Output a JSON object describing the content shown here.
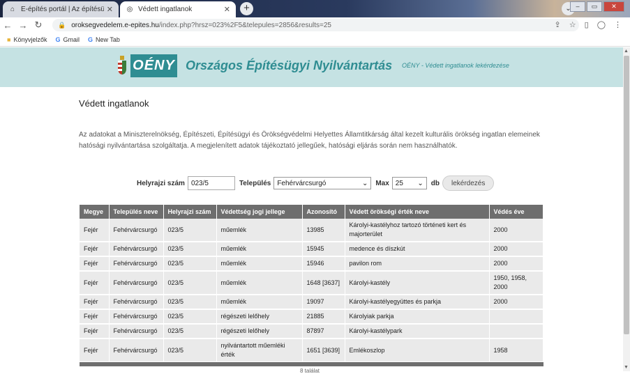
{
  "browser": {
    "tabs": [
      {
        "title": "E-építés portál | Az építésügy po",
        "icon": "home-icon"
      },
      {
        "title": "Védett ingatlanok",
        "icon": "globe-icon"
      }
    ],
    "url_host": "oroksegvedelem.e-epites.hu",
    "url_path": "/index.php?hrsz=023%2F5&telepules=2856&results=25",
    "bookmarks": [
      "Könyvjelzők",
      "Gmail",
      "New Tab"
    ]
  },
  "banner": {
    "logo": "OÉNY",
    "title": "Országos Építésügyi Nyilvántartás",
    "subtitle": "OÉNY - Védett ingatlanok lekérdezése"
  },
  "page": {
    "title": "Védett ingatlanok",
    "intro": "Az adatokat a Miniszterelnökség, Építészeti, Építésügyi és Örökségvédelmi Helyettes Államtitkárság által kezelt kulturális örökség ingatlan elemeinek hatósági nyilvántartása szolgáltatja. A megjelenített adatok tájékoztató jellegűek, hatósági eljárás során nem használhatók."
  },
  "form": {
    "hrsz_label": "Helyrajzi szám",
    "hrsz_value": "023/5",
    "telepules_label": "Település",
    "telepules_value": "Fehérvárcsurgó",
    "max_label": "Max",
    "max_value": "25",
    "db_label": "db",
    "submit_label": "lekérdezés"
  },
  "table": {
    "headers": [
      "Megye",
      "Település neve",
      "Helyrajzi szám",
      "Védettség jogi jellege",
      "Azonosító",
      "Védett örökségi érték neve",
      "Védés éve"
    ],
    "rows": [
      [
        "Fejér",
        "Fehérvárcsurgó",
        "023/5",
        "műemlék",
        "13985",
        "Károlyi-kastélyhoz tartozó történeti kert és majorterület",
        "2000"
      ],
      [
        "Fejér",
        "Fehérvárcsurgó",
        "023/5",
        "műemlék",
        "15945",
        "medence és díszkút",
        "2000"
      ],
      [
        "Fejér",
        "Fehérvárcsurgó",
        "023/5",
        "műemlék",
        "15946",
        "pavilon rom",
        "2000"
      ],
      [
        "Fejér",
        "Fehérvárcsurgó",
        "023/5",
        "műemlék",
        "1648 [3637]",
        "Károlyi-kastély",
        "1950, 1958, 2000"
      ],
      [
        "Fejér",
        "Fehérvárcsurgó",
        "023/5",
        "műemlék",
        "19097",
        "Károlyi-kastélyegyüttes és parkja",
        "2000"
      ],
      [
        "Fejér",
        "Fehérvárcsurgó",
        "023/5",
        "régészeti lelőhely",
        "21885",
        "Károlyiak parkja",
        ""
      ],
      [
        "Fejér",
        "Fehérvárcsurgó",
        "023/5",
        "régészeti lelőhely",
        "87897",
        "Károlyi-kastélypark",
        ""
      ],
      [
        "Fejér",
        "Fehérvárcsurgó",
        "023/5",
        "nyilvántartott műemléki érték",
        "1651 [3639]",
        "Emlékoszlop",
        "1958"
      ]
    ],
    "count_text": "8 találat"
  }
}
